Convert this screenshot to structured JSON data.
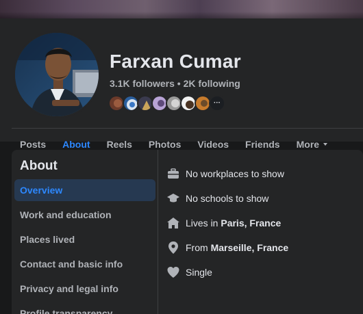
{
  "profile": {
    "name": "Farxan Cumar",
    "stats": "3.1K followers • 2K following",
    "friends_more_glyph": "···"
  },
  "tabs": [
    {
      "label": "Posts"
    },
    {
      "label": "About"
    },
    {
      "label": "Reels"
    },
    {
      "label": "Photos"
    },
    {
      "label": "Videos"
    },
    {
      "label": "Friends"
    },
    {
      "label": "More"
    }
  ],
  "about": {
    "title": "About",
    "side_items": [
      {
        "label": "Overview"
      },
      {
        "label": "Work and education"
      },
      {
        "label": "Places lived"
      },
      {
        "label": "Contact and basic info"
      },
      {
        "label": "Privacy and legal info"
      },
      {
        "label": "Profile transparency"
      }
    ],
    "overview": {
      "work": "No workplaces to show",
      "school": "No schools to show",
      "lives_prefix": "Lives in ",
      "lives_place": "Paris, France",
      "from_prefix": "From ",
      "from_place": "Marseille, France",
      "relationship": "Single"
    }
  },
  "colors": {
    "accent": "#2d88ff",
    "background": "#18191a",
    "card": "#242526",
    "text_primary": "#e4e6eb",
    "text_secondary": "#b0b3b8",
    "icon": "#b0b3b8"
  },
  "icons": {
    "work": "briefcase-icon",
    "school": "graduation-cap-icon",
    "lives": "home-icon",
    "from": "location-pin-icon",
    "relationship": "heart-icon",
    "more_tab": "caret-down-icon"
  }
}
